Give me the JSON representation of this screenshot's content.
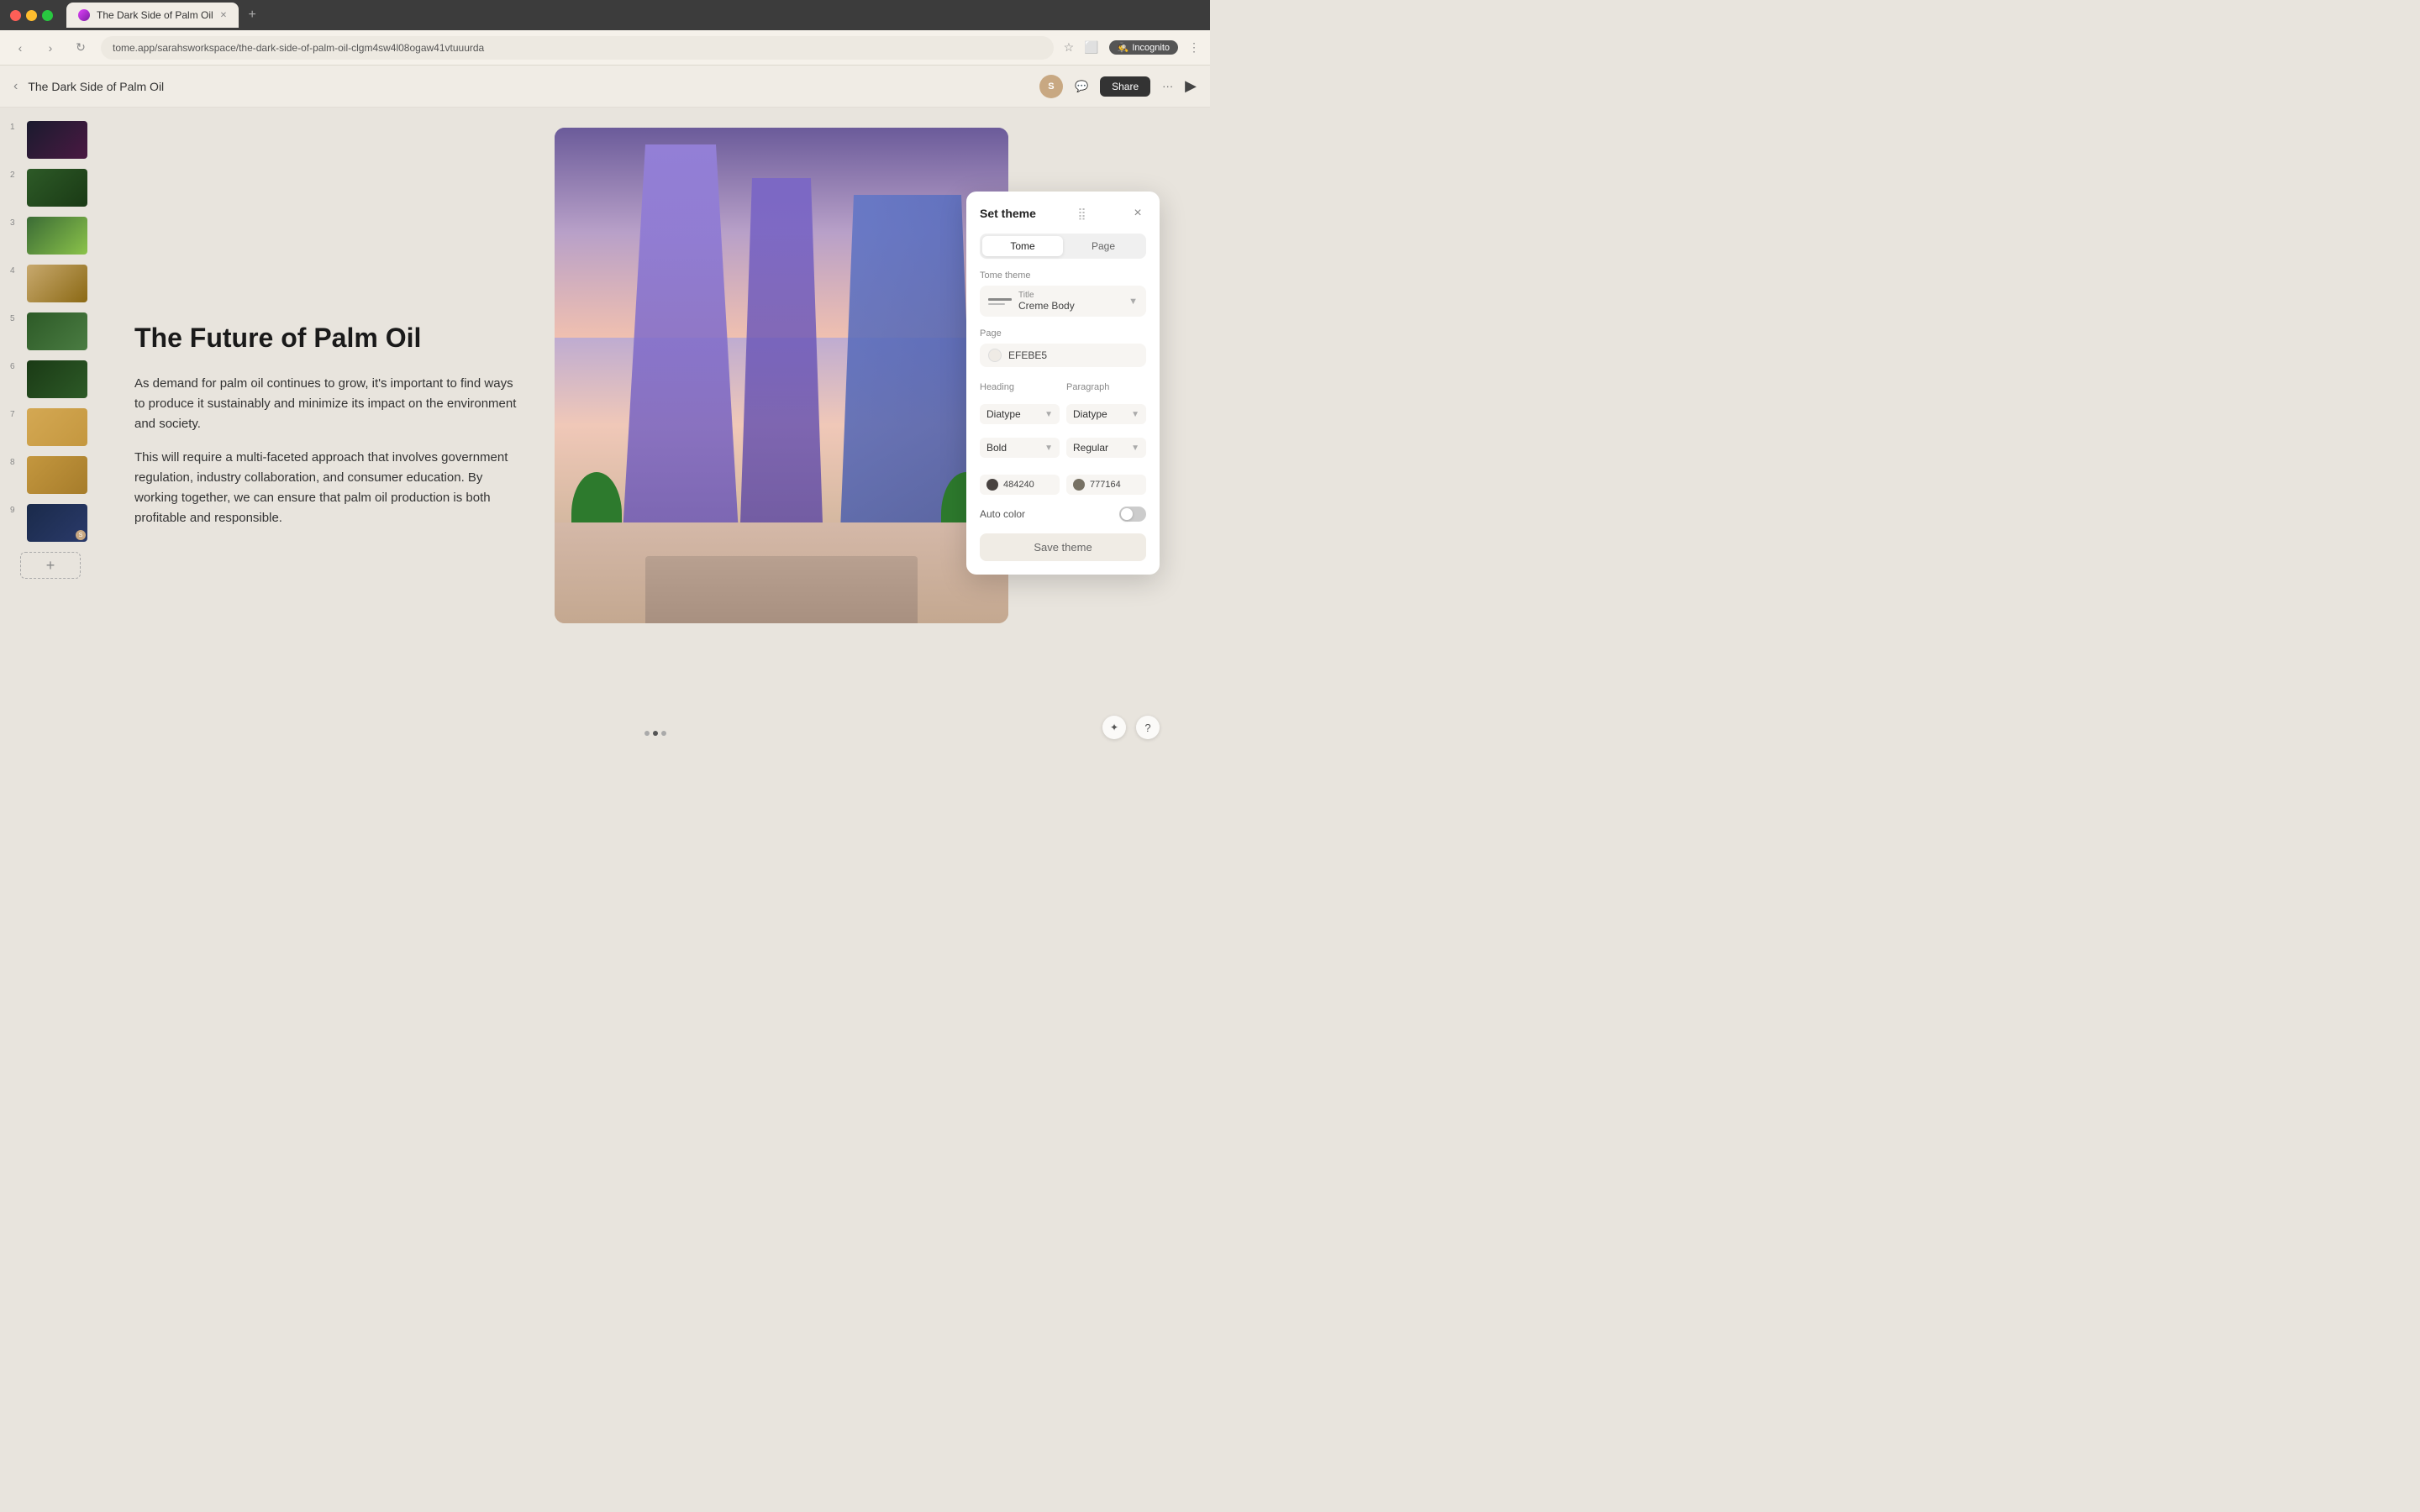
{
  "browser": {
    "tab_title": "The Dark Side of Palm Oil",
    "url": "tome.app/sarahsworkspace/the-dark-side-of-palm-oil-clgm4sw4l08ogaw41vtuuurda",
    "incognito_label": "Incognito"
  },
  "toolbar": {
    "back_label": "‹",
    "title": "The Dark Side of Palm Oil",
    "share_label": "Share",
    "avatar_label": "S"
  },
  "sidebar": {
    "items": [
      {
        "num": "1",
        "thumb_class": "thumb-1"
      },
      {
        "num": "2",
        "thumb_class": "thumb-2"
      },
      {
        "num": "3",
        "thumb_class": "thumb-3"
      },
      {
        "num": "4",
        "thumb_class": "thumb-4"
      },
      {
        "num": "5",
        "thumb_class": "thumb-5"
      },
      {
        "num": "6",
        "thumb_class": "thumb-6"
      },
      {
        "num": "7",
        "thumb_class": "thumb-7"
      },
      {
        "num": "8",
        "thumb_class": "thumb-8"
      },
      {
        "num": "9",
        "thumb_class": "thumb-9",
        "has_avatar": true
      }
    ],
    "add_label": "+"
  },
  "slide": {
    "heading": "The Future of Palm Oil",
    "para1": "As demand for palm oil continues to grow, it's important to find ways to produce it sustainably and minimize its impact on the environment and society.",
    "para2": "This will require a multi-faceted approach that involves government regulation, industry collaboration, and consumer education. By working together, we can ensure that palm oil production is both profitable and responsible."
  },
  "theme_dialog": {
    "title": "Set theme",
    "close_icon": "×",
    "tabs": [
      {
        "label": "Tome",
        "active": true
      },
      {
        "label": "Page",
        "active": false
      }
    ],
    "tome_theme_label": "Tome theme",
    "theme_options": {
      "title_label": "Title",
      "body_label": "Creme Body",
      "selected": "Creme"
    },
    "page_label": "Page",
    "page_color": "EFEBE5",
    "heading_label": "Heading",
    "paragraph_label": "Paragraph",
    "heading_font": "Diatype",
    "heading_weight": "Bold",
    "paragraph_font": "Diatype",
    "paragraph_weight": "Regular",
    "heading_color": "484240",
    "paragraph_color": "777164",
    "auto_color_label": "Auto color",
    "save_label": "Save theme"
  }
}
